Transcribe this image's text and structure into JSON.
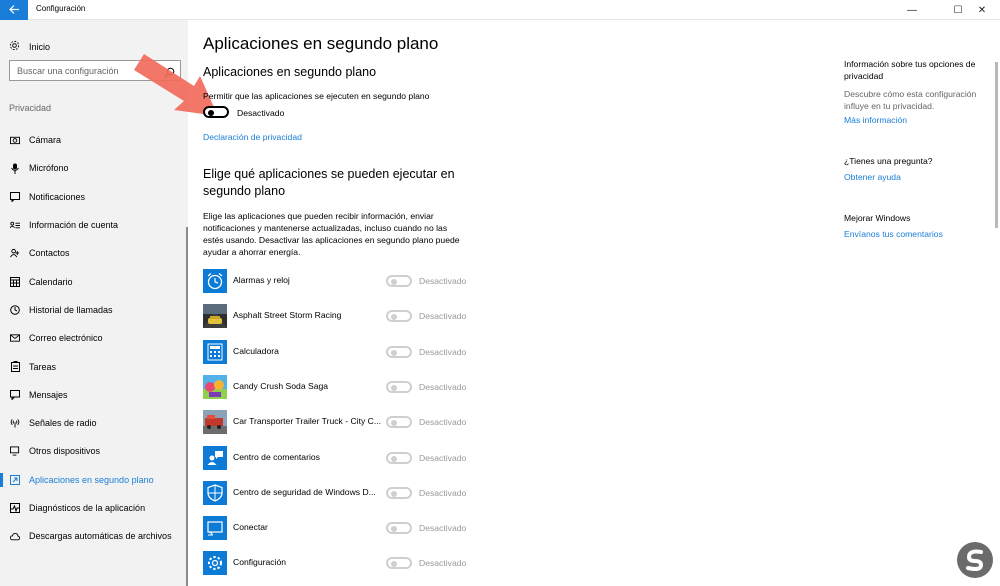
{
  "window": {
    "title": "Configuración",
    "back_icon": "arrow-left-icon",
    "minimize_glyph": "—",
    "maximize_glyph": "☐",
    "close_glyph": "✕",
    "accent_color": "#1a7dd7"
  },
  "sidebar": {
    "home_label": "Inicio",
    "search_placeholder": "Buscar una configuración",
    "section_label": "Privacidad",
    "items": [
      {
        "label": "Cámara",
        "icon": "camera-icon"
      },
      {
        "label": "Micrófono",
        "icon": "microphone-icon"
      },
      {
        "label": "Notificaciones",
        "icon": "notifications-icon"
      },
      {
        "label": "Información de cuenta",
        "icon": "account-info-icon"
      },
      {
        "label": "Contactos",
        "icon": "contacts-icon"
      },
      {
        "label": "Calendario",
        "icon": "calendar-icon"
      },
      {
        "label": "Historial de llamadas",
        "icon": "call-history-icon"
      },
      {
        "label": "Correo electrónico",
        "icon": "mail-icon"
      },
      {
        "label": "Tareas",
        "icon": "tasks-icon"
      },
      {
        "label": "Mensajes",
        "icon": "messages-icon"
      },
      {
        "label": "Señales de radio",
        "icon": "radio-icon"
      },
      {
        "label": "Otros dispositivos",
        "icon": "devices-icon"
      },
      {
        "label": "Aplicaciones en segundo plano",
        "icon": "background-apps-icon",
        "active": true
      },
      {
        "label": "Diagnósticos de la aplicación",
        "icon": "diagnostics-icon"
      },
      {
        "label": "Descargas automáticas de archivos",
        "icon": "cloud-download-icon"
      }
    ]
  },
  "main": {
    "page_title": "Aplicaciones en segundo plano",
    "section1_title": "Aplicaciones en segundo plano",
    "allow_label": "Permitir que las aplicaciones se ejecuten en segundo plano",
    "main_toggle_state": "Desactivado",
    "privacy_link": "Declaración de privacidad",
    "section2_title_line1": "Elige qué aplicaciones se pueden ejecutar en",
    "section2_title_line2": "segundo plano",
    "description_lines": [
      "Elige las aplicaciones que pueden recibir información, enviar",
      "notificaciones y mantenerse actualizadas, incluso cuando no las",
      "estés usando. Desactivar las aplicaciones en segundo plano puede",
      "ayudar a ahorrar energía."
    ],
    "apps": [
      {
        "name": "Alarmas y reloj",
        "state": "Desactivado",
        "icon": "alarm-clock-icon"
      },
      {
        "name": "Asphalt Street Storm Racing",
        "state": "Desactivado",
        "icon": "racing-game-icon"
      },
      {
        "name": "Calculadora",
        "state": "Desactivado",
        "icon": "calculator-icon"
      },
      {
        "name": "Candy Crush Soda Saga",
        "state": "Desactivado",
        "icon": "candy-game-icon"
      },
      {
        "name": "Car Transporter Trailer Truck - City C...",
        "state": "Desactivado",
        "icon": "truck-game-icon"
      },
      {
        "name": "Centro de comentarios",
        "state": "Desactivado",
        "icon": "feedback-hub-icon"
      },
      {
        "name": "Centro de seguridad de Windows D...",
        "state": "Desactivado",
        "icon": "shield-icon"
      },
      {
        "name": "Conectar",
        "state": "Desactivado",
        "icon": "connect-icon"
      },
      {
        "name": "Configuración",
        "state": "Desactivado",
        "icon": "settings-gear-icon"
      }
    ]
  },
  "right": {
    "info_heading": "Información sobre tus opciones de privacidad",
    "info_text": "Descubre cómo esta configuración influye en tu privacidad.",
    "info_link": "Más información",
    "question_heading": "¿Tienes una pregunta?",
    "help_link": "Obtener ayuda",
    "improve_heading": "Mejorar Windows",
    "feedback_link": "Envíanos tus comentarios"
  }
}
